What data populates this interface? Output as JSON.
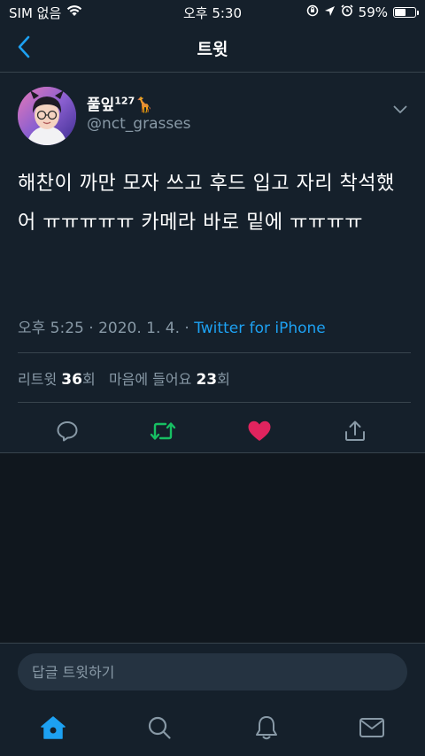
{
  "status_bar": {
    "carrier": "SIM 없음",
    "time": "오후 5:30",
    "battery_percent_text": "59%",
    "battery_level": 0.59
  },
  "header": {
    "title": "트윗",
    "back_icon": "chevron-left-icon"
  },
  "tweet": {
    "author": {
      "display_name": "풀잎",
      "display_name_sup": "127",
      "display_name_emoji": "🦒",
      "handle": "@nct_grasses"
    },
    "text": "해찬이 까만 모자 쓰고 후드 입고 자리 착석했어 ㅠㅠㅠㅠㅠ 카메라 바로 밑에 ㅠㅠㅠㅠ",
    "timestamp": "오후 5:25 · 2020. 1. 4. · ",
    "source": "Twitter for iPhone",
    "stats": {
      "retweet_label": "리트윗",
      "retweet_count": "36",
      "retweet_suffix": "회",
      "like_label": "마음에 들어요",
      "like_count": "23",
      "like_suffix": "회"
    }
  },
  "actions": {
    "reply_icon": "reply-icon",
    "retweet_icon": "retweet-icon",
    "like_icon": "heart-icon",
    "share_icon": "share-icon"
  },
  "reply": {
    "placeholder": "답글 트윗하기"
  },
  "tab_bar": {
    "items": [
      "home-icon",
      "search-icon",
      "notifications-icon",
      "messages-icon"
    ]
  },
  "colors": {
    "background": "#15202b",
    "accent": "#1da1f2",
    "retweet_green": "#17bf63",
    "like_red": "#e0245e",
    "secondary_text": "#8899a6"
  }
}
